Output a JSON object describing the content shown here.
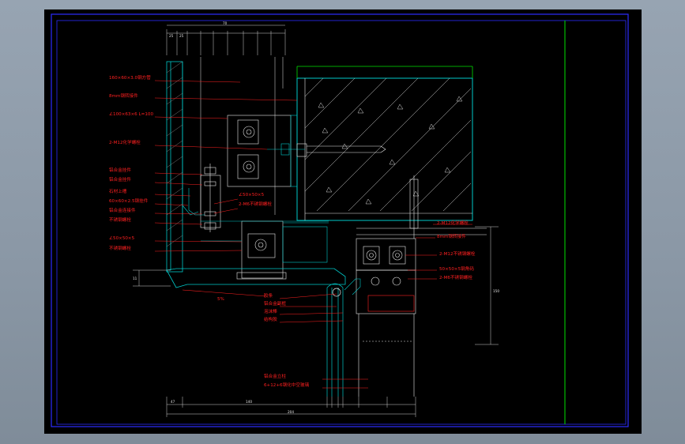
{
  "drawing": {
    "callouts_left": [
      "160×60×3.0钢方管",
      "8mm钢转接件",
      "∠100×63×6  L=100",
      "2-M12化学螺栓",
      "铝合金挂件",
      "铝合金挂件",
      "石材上槽",
      "60×60×2.5钢挂件",
      "铝合金连接件",
      "不锈钢螺栓",
      "∠50×50×5",
      "不锈钢螺栓"
    ],
    "callouts_mid": [
      "∠50×50×5",
      "2-M6不锈钢螺栓"
    ],
    "callouts_bottom": [
      "胶条",
      "铝合金副框",
      "泡沫棒",
      "结构胶",
      "铝合金立柱",
      "6+12+6钢化中空玻璃"
    ],
    "callouts_right": [
      "2-M12化学螺栓",
      "8mm钢转接件",
      "2-M12不锈钢螺栓",
      "50×50×5钢角码",
      "2-M6不锈钢螺栓"
    ],
    "slope_label": "5%",
    "dims_top": [
      "25",
      "25",
      "70"
    ],
    "dims_bottom": [
      "47",
      "140",
      "204"
    ],
    "dim_right": "150",
    "dim_left": "11"
  },
  "colors": {
    "background_outer": "#8e9ba8",
    "canvas": "#000000",
    "frame": "#2b2bff",
    "label": "#ff2020",
    "structure": "#00c8c8",
    "concrete": "#e8e8e8",
    "highlight": "#00e000"
  }
}
